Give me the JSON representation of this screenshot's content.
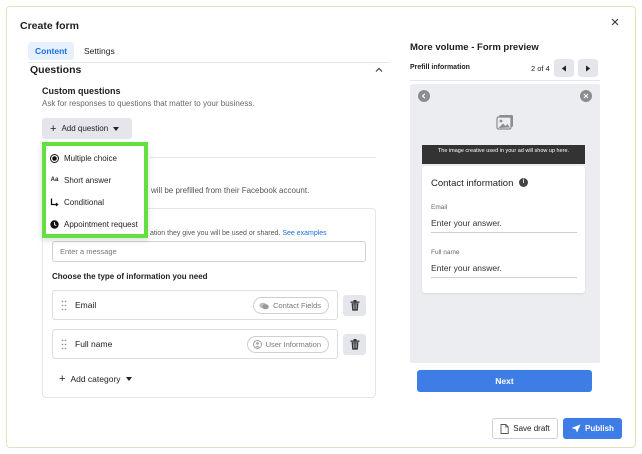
{
  "modal": {
    "title": "Create form",
    "close_icon": "close-icon"
  },
  "tabs": [
    {
      "label": "Content",
      "active": true
    },
    {
      "label": "Settings",
      "active": false
    }
  ],
  "questions": {
    "heading": "Questions",
    "custom_title": "Custom questions",
    "custom_subtitle": "Ask for responses to questions that matter to your business.",
    "add_question_label": "Add question",
    "menu": [
      {
        "label": "Multiple choice",
        "icon": "radio-filled-icon"
      },
      {
        "label": "Short answer",
        "icon": "text-aa-icon"
      },
      {
        "label": "Conditional",
        "icon": "branch-icon"
      },
      {
        "label": "Appointment request",
        "icon": "clock-icon"
      }
    ],
    "prefill_text": "will be prefilled from their Facebook account.",
    "privacy_text": "ation they give you will be used or shared.",
    "privacy_link": "See examples",
    "message_placeholder": "Enter a message",
    "choose_label": "Choose the type of information you need",
    "fields": [
      {
        "name": "Email",
        "tag": "Contact Fields",
        "tag_icon": "chat-bubbles-icon"
      },
      {
        "name": "Full name",
        "tag": "User Information",
        "tag_icon": "user-icon"
      }
    ],
    "add_category_label": "Add category"
  },
  "preview": {
    "title": "More volume - Form preview",
    "section_label": "Prefill information",
    "page_indicator": "2 of 4",
    "banner_text": "The image creative used in your ad will show up here.",
    "card_title": "Contact information",
    "info_icon": "i",
    "fields": [
      {
        "label": "Email",
        "placeholder": "Enter your answer."
      },
      {
        "label": "Full name",
        "placeholder": "Enter your answer."
      }
    ],
    "next_label": "Next"
  },
  "footer": {
    "save_label": "Save draft",
    "publish_label": "Publish"
  },
  "colors": {
    "accent": "#3e7ce6",
    "tab_active_bg": "#e7f0fd",
    "highlight_border": "#63e03f"
  }
}
